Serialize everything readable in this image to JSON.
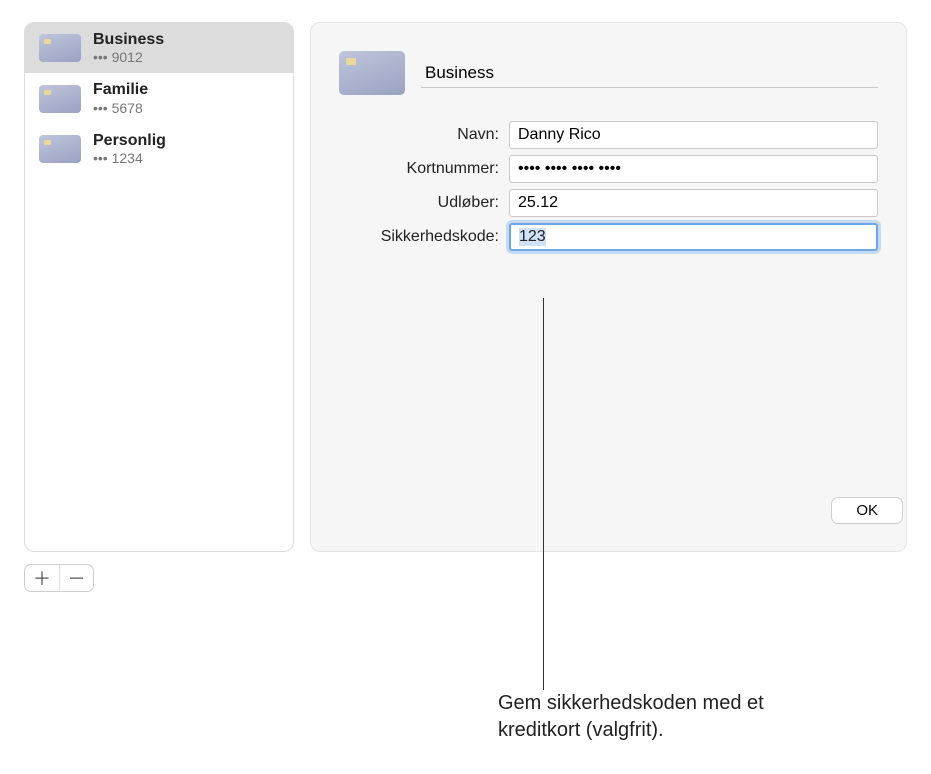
{
  "sidebar": {
    "items": [
      {
        "title": "Business",
        "sub": "••• 9012",
        "selected": true
      },
      {
        "title": "Familie",
        "sub": "••• 5678",
        "selected": false
      },
      {
        "title": "Personlig",
        "sub": "••• 1234",
        "selected": false
      }
    ]
  },
  "buttons": {
    "add": "＋",
    "remove": "－",
    "ok": "OK"
  },
  "detail": {
    "title_value": "Business",
    "rows": {
      "name": {
        "label": "Navn:",
        "value": "Danny Rico"
      },
      "number": {
        "label": "Kortnummer:",
        "value": "•••• •••• •••• ••••"
      },
      "expiry": {
        "label": "Udløber:",
        "value": "25.12"
      },
      "cvc": {
        "label": "Sikkerhedskode:",
        "value": "123"
      }
    }
  },
  "callout": "Gem sikkerhedskoden med et kreditkort (valgfrit)."
}
